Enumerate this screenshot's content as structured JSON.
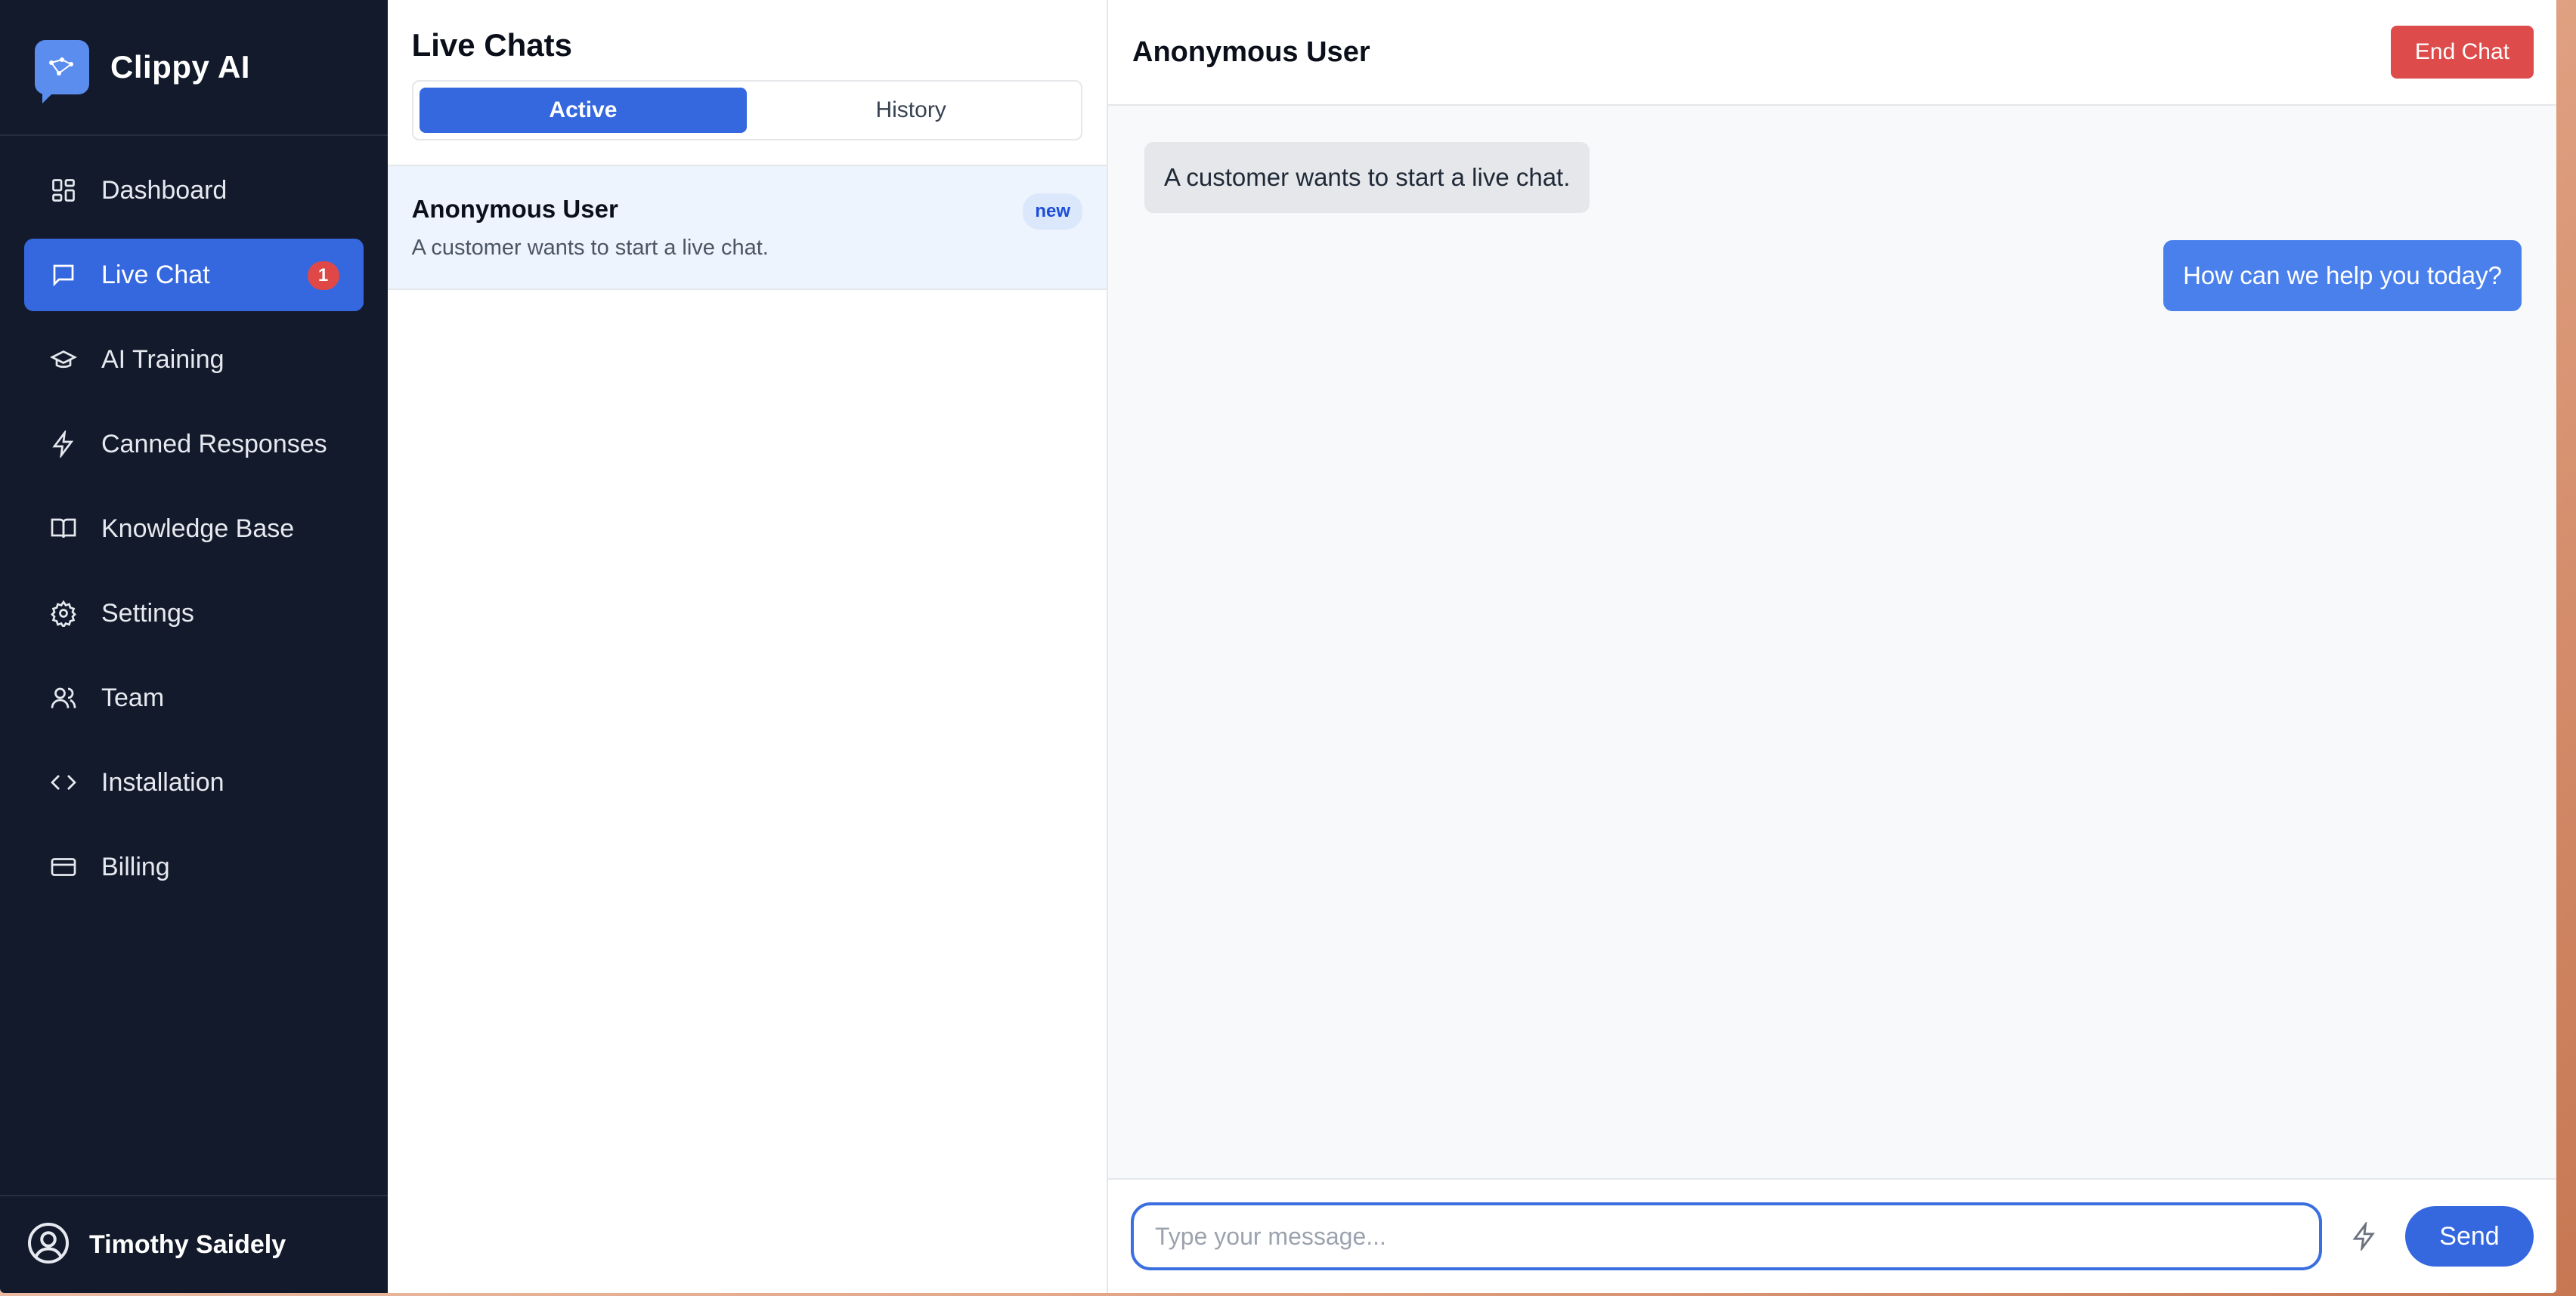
{
  "brand": {
    "name": "Clippy AI"
  },
  "sidebar": {
    "items": [
      {
        "label": "Dashboard",
        "icon": "dashboard-icon"
      },
      {
        "label": "Live Chat",
        "icon": "chat-icon",
        "badge": "1",
        "active": true
      },
      {
        "label": "AI Training",
        "icon": "graduation-cap-icon"
      },
      {
        "label": "Canned Responses",
        "icon": "bolt-icon"
      },
      {
        "label": "Knowledge Base",
        "icon": "book-icon"
      },
      {
        "label": "Settings",
        "icon": "gear-icon"
      },
      {
        "label": "Team",
        "icon": "users-icon"
      },
      {
        "label": "Installation",
        "icon": "code-icon"
      },
      {
        "label": "Billing",
        "icon": "credit-card-icon"
      }
    ],
    "user": {
      "name": "Timothy Saidely"
    }
  },
  "chatlist": {
    "title": "Live Chats",
    "tabs": [
      {
        "label": "Active",
        "active": true
      },
      {
        "label": "History",
        "active": false
      }
    ],
    "items": [
      {
        "name": "Anonymous User",
        "preview": "A customer wants to start a live chat.",
        "badge": "new"
      }
    ]
  },
  "conversation": {
    "title": "Anonymous User",
    "end_label": "End Chat",
    "messages": [
      {
        "from": "customer",
        "text": "A customer wants to start a live chat."
      },
      {
        "from": "agent",
        "text": "How can we help you today?"
      }
    ],
    "composer": {
      "placeholder": "Type your message...",
      "send_label": "Send"
    }
  },
  "colors": {
    "accent": "#3568df",
    "sidebar_bg": "#131a2b",
    "danger": "#de4b4b",
    "agent_bubble": "#4a80ec"
  }
}
